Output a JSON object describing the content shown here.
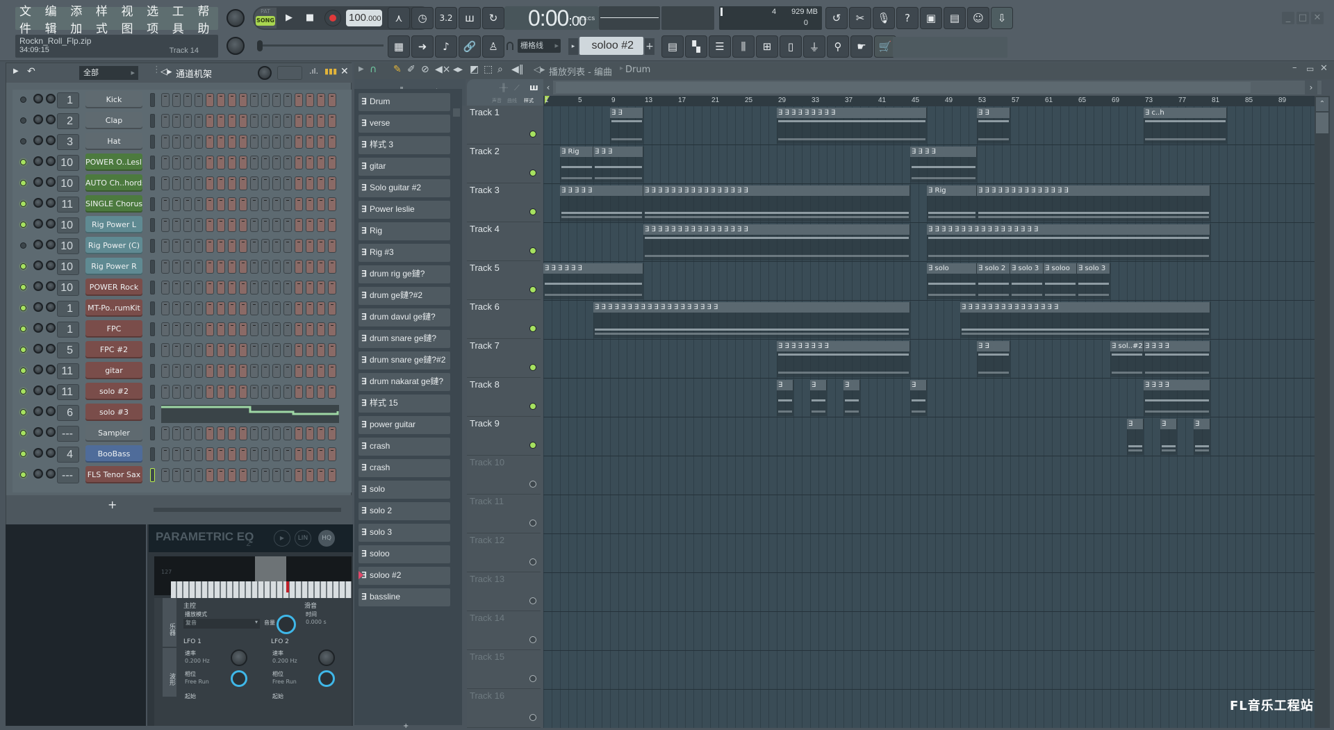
{
  "menu": {
    "items": [
      "文件",
      "编辑",
      "添加",
      "样式",
      "视图",
      "选项",
      "工具",
      "帮助"
    ]
  },
  "song": {
    "filename": "Rockn_Roll_Flp.zip",
    "time": "34:09:15",
    "track_hint": "Track 14"
  },
  "transport": {
    "pat_label": "PAT",
    "song_label": "SONG",
    "tempo_int": "100",
    "tempo_dec": ".000",
    "time_main": "0:00",
    "time_cs": "00",
    "time_format": "M:S:CS"
  },
  "cpu": {
    "polyphony": "4",
    "memory": "929 MB",
    "voices": "0"
  },
  "toolbar2": {
    "snap": "栅格线",
    "pattern": "soloo #2",
    "add": "+"
  },
  "rack": {
    "filter": "全部",
    "title": "通道机架",
    "add": "+",
    "channels": [
      {
        "num": "1",
        "name": "Kick",
        "color": "#5f6a70",
        "led": false
      },
      {
        "num": "2",
        "name": "Clap",
        "color": "#5f6a70",
        "led": false
      },
      {
        "num": "3",
        "name": "Hat",
        "color": "#5f6a70",
        "led": false
      },
      {
        "num": "10",
        "name": "POWER O..Leslie",
        "color": "#4c7a3e",
        "led": true
      },
      {
        "num": "10",
        "name": "AUTO Ch..hords",
        "color": "#4c7a3e",
        "led": true
      },
      {
        "num": "11",
        "name": "SINGLE Chorus",
        "color": "#4c7a3e",
        "led": true
      },
      {
        "num": "10",
        "name": "Rig Power L",
        "color": "#5f8a92",
        "led": true
      },
      {
        "num": "10",
        "name": "Rig Power (C)",
        "color": "#5f8a92",
        "led": false
      },
      {
        "num": "10",
        "name": "Rig Power R",
        "color": "#5f8a92",
        "led": true
      },
      {
        "num": "10",
        "name": "POWER Rock",
        "color": "#7a4d4a",
        "led": true
      },
      {
        "num": "1",
        "name": "MT-Po..rumKit",
        "color": "#7a4d4a",
        "led": true
      },
      {
        "num": "1",
        "name": "FPC",
        "color": "#7a4d4a",
        "led": true
      },
      {
        "num": "5",
        "name": "FPC #2",
        "color": "#7a4d4a",
        "led": true
      },
      {
        "num": "11",
        "name": "gitar",
        "color": "#7a4d4a",
        "led": true
      },
      {
        "num": "11",
        "name": "solo #2",
        "color": "#7a4d4a",
        "led": true
      },
      {
        "num": "6",
        "name": "solo #3",
        "color": "#7a4d4a",
        "led": true
      },
      {
        "num": "---",
        "name": "Sampler",
        "color": "#5f6a70",
        "led": true
      },
      {
        "num": "4",
        "name": "BooBass",
        "color": "#4f6c9a",
        "led": true
      },
      {
        "num": "---",
        "name": "FLS Tenor Sax",
        "color": "#7a4d4a",
        "led": true
      }
    ]
  },
  "picker": {
    "patterns": [
      "Drum",
      "verse",
      "样式 3",
      "gitar",
      "Solo guitar #2",
      "Power leslie",
      "Rig",
      "Rig  #3",
      "drum rig ge鏈?",
      "drum ge鏈?#2",
      "drum davul ge鏈?",
      "drum snare ge鏈?",
      "drum snare ge鏈?#2",
      "drum nakarat ge鏈?",
      "样式 15",
      "power guitar",
      "crash",
      "crash",
      "solo",
      "solo 2",
      "solo 3",
      "soloo",
      "soloo #2",
      "bassline"
    ],
    "selected": "soloo #2",
    "tabs": [
      "声音",
      "曲线",
      "样式"
    ]
  },
  "playlist": {
    "title": "播放列表 - 编曲",
    "breadcrumb": "Drum",
    "bars": [
      "1",
      "5",
      "9",
      "13",
      "17",
      "21",
      "25",
      "29",
      "33",
      "37",
      "41",
      "45",
      "49",
      "53",
      "57",
      "61",
      "65",
      "69",
      "73",
      "77",
      "81",
      "85",
      "89"
    ],
    "tracks": [
      {
        "name": "Track 1",
        "active": true
      },
      {
        "name": "Track 2",
        "active": true
      },
      {
        "name": "Track 3",
        "active": true
      },
      {
        "name": "Track 4",
        "active": true
      },
      {
        "name": "Track 5",
        "active": true
      },
      {
        "name": "Track 6",
        "active": true
      },
      {
        "name": "Track 7",
        "active": true
      },
      {
        "name": "Track 8",
        "active": true
      },
      {
        "name": "Track 9",
        "active": true
      },
      {
        "name": "Track 10",
        "active": false
      },
      {
        "name": "Track 11",
        "active": false
      },
      {
        "name": "Track 12",
        "active": false
      },
      {
        "name": "Track 13",
        "active": false
      },
      {
        "name": "Track 14",
        "active": false
      },
      {
        "name": "Track 15",
        "active": false
      },
      {
        "name": "Track 16",
        "active": false
      }
    ],
    "clips": [
      {
        "track": 0,
        "start": 9,
        "len": 4,
        "label": ""
      },
      {
        "track": 0,
        "start": 29,
        "len": 18,
        "label": ""
      },
      {
        "track": 0,
        "start": 53,
        "len": 4,
        "label": ""
      },
      {
        "track": 0,
        "start": 73,
        "len": 10,
        "label": "c..h"
      },
      {
        "track": 1,
        "start": 3,
        "len": 4,
        "label": "Rig"
      },
      {
        "track": 1,
        "start": 7,
        "len": 6,
        "label": ""
      },
      {
        "track": 1,
        "start": 45,
        "len": 8,
        "label": ""
      },
      {
        "track": 2,
        "start": 3,
        "len": 10,
        "label": ""
      },
      {
        "track": 2,
        "start": 13,
        "len": 32,
        "label": ""
      },
      {
        "track": 2,
        "start": 47,
        "len": 6,
        "label": "Rig"
      },
      {
        "track": 2,
        "start": 53,
        "len": 28,
        "label": ""
      },
      {
        "track": 3,
        "start": 13,
        "len": 32,
        "label": ""
      },
      {
        "track": 3,
        "start": 47,
        "len": 34,
        "label": ""
      },
      {
        "track": 4,
        "start": 1,
        "len": 12,
        "label": ""
      },
      {
        "track": 4,
        "start": 47,
        "len": 6,
        "label": "solo"
      },
      {
        "track": 4,
        "start": 53,
        "len": 4,
        "label": "solo 2"
      },
      {
        "track": 4,
        "start": 57,
        "len": 4,
        "label": "solo 3"
      },
      {
        "track": 4,
        "start": 61,
        "len": 4,
        "label": "soloo"
      },
      {
        "track": 4,
        "start": 65,
        "len": 4,
        "label": "solo 3"
      },
      {
        "track": 5,
        "start": 7,
        "len": 38,
        "label": ""
      },
      {
        "track": 5,
        "start": 51,
        "len": 30,
        "label": ""
      },
      {
        "track": 6,
        "start": 29,
        "len": 16,
        "label": ""
      },
      {
        "track": 6,
        "start": 53,
        "len": 4,
        "label": ""
      },
      {
        "track": 6,
        "start": 69,
        "len": 4,
        "label": "sol..#2"
      },
      {
        "track": 6,
        "start": 73,
        "len": 8,
        "label": ""
      },
      {
        "track": 7,
        "start": 29,
        "len": 2,
        "label": ""
      },
      {
        "track": 7,
        "start": 33,
        "len": 2,
        "label": ""
      },
      {
        "track": 7,
        "start": 37,
        "len": 2,
        "label": ""
      },
      {
        "track": 7,
        "start": 45,
        "len": 2,
        "label": ""
      },
      {
        "track": 7,
        "start": 73,
        "len": 8,
        "label": ""
      },
      {
        "track": 8,
        "start": 71,
        "len": 2,
        "label": ""
      },
      {
        "track": 8,
        "start": 75,
        "len": 2,
        "label": ""
      },
      {
        "track": 8,
        "start": 79,
        "len": 2,
        "label": ""
      }
    ]
  },
  "plugin": {
    "title": "PARAMETRIC EQ",
    "version": "2",
    "lin": "LIN",
    "hq": "HQ",
    "velocity_label": "127",
    "tab1": "乐器",
    "tab2": "波形",
    "main_label": "主控",
    "play_mode_label": "播放模式",
    "play_mode_value": "复音",
    "volume_label": "音量",
    "glide_label": "滑音",
    "time_label": "时间",
    "time_value": "0.000 s",
    "lfo1": {
      "title": "LFO 1",
      "rate_label": "速率",
      "rate_value": "0.200 Hz",
      "phase_label": "相位",
      "phase_value": "Free Run",
      "start_label": "起始"
    },
    "lfo2": {
      "title": "LFO 2",
      "rate_label": "速率",
      "rate_value": "0.200 Hz",
      "phase_label": "相位",
      "phase_value": "Free Run",
      "start_label": "起始"
    }
  },
  "watermark": "FL音乐工程站"
}
